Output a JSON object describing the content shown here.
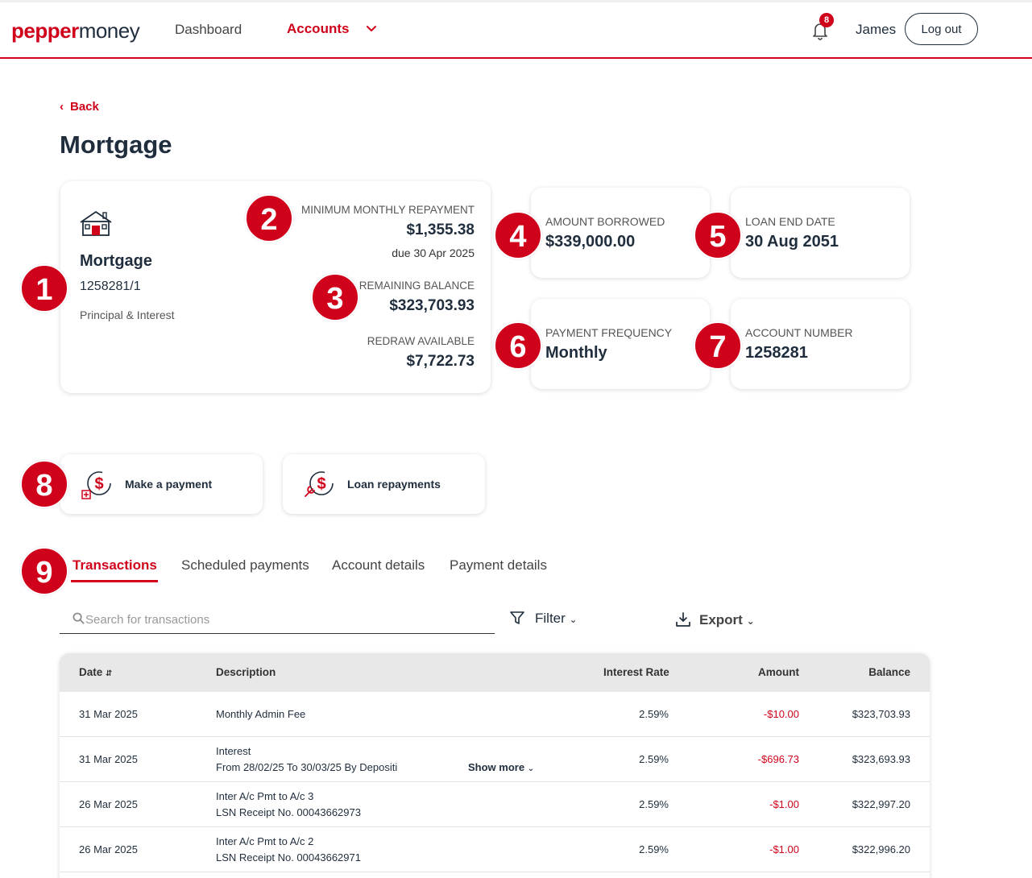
{
  "header": {
    "logo_part1": "pepper",
    "logo_part2": "money",
    "nav_dashboard": "Dashboard",
    "nav_accounts": "Accounts",
    "notification_count": "8",
    "user_name": "James",
    "logout_label": "Log out"
  },
  "colors": {
    "brand": "#d0021b",
    "text": "#1f2d3d"
  },
  "back_label": "Back",
  "page_title": "Mortgage",
  "account_card": {
    "name": "Mortgage",
    "number": "1258281/1",
    "type": "Principal & Interest",
    "min_repayment_label": "MINIMUM MONTHLY REPAYMENT",
    "min_repayment_value": "$1,355.38",
    "due_text": "due 30 Apr 2025",
    "remaining_label": "REMAINING BALANCE",
    "remaining_value": "$323,703.93",
    "redraw_label": "REDRAW AVAILABLE",
    "redraw_value": "$7,722.73"
  },
  "info_cards": [
    {
      "label": "AMOUNT BORROWED",
      "value": "$339,000.00"
    },
    {
      "label": "LOAN END DATE",
      "value": "30 Aug 2051"
    },
    {
      "label": "PAYMENT FREQUENCY",
      "value": "Monthly"
    },
    {
      "label": "ACCOUNT NUMBER",
      "value": "1258281"
    }
  ],
  "markers": [
    "1",
    "2",
    "3",
    "4",
    "5",
    "6",
    "7",
    "8",
    "9"
  ],
  "actions": {
    "make_payment": "Make a payment",
    "loan_repayments": "Loan repayments"
  },
  "tabs": [
    "Transactions",
    "Scheduled payments",
    "Account details",
    "Payment details"
  ],
  "search": {
    "placeholder": "Search for transactions"
  },
  "filter_label": "Filter",
  "export_label": "Export",
  "table": {
    "headers": {
      "date": "Date",
      "description": "Description",
      "rate": "Interest Rate",
      "amount": "Amount",
      "balance": "Balance"
    },
    "show_more": "Show more",
    "rows": [
      {
        "date": "31 Mar 2025",
        "desc1": "Monthly Admin Fee",
        "desc2": "",
        "rate": "2.59%",
        "amount": "-$10.00",
        "balance": "$323,703.93"
      },
      {
        "date": "31 Mar 2025",
        "desc1": "Interest",
        "desc2": "From 28/02/25 To 30/03/25 By Depositi",
        "rate": "2.59%",
        "amount": "-$696.73",
        "balance": "$323,693.93"
      },
      {
        "date": "26 Mar 2025",
        "desc1": "Inter A/c Pmt to A/c 3",
        "desc2": "LSN Receipt No. 00043662973",
        "rate": "2.59%",
        "amount": "-$1.00",
        "balance": "$322,997.20"
      },
      {
        "date": "26 Mar 2025",
        "desc1": "Inter A/c Pmt to A/c 2",
        "desc2": "LSN Receipt No. 00043662971",
        "rate": "2.59%",
        "amount": "-$1.00",
        "balance": "$322,996.20"
      }
    ]
  }
}
